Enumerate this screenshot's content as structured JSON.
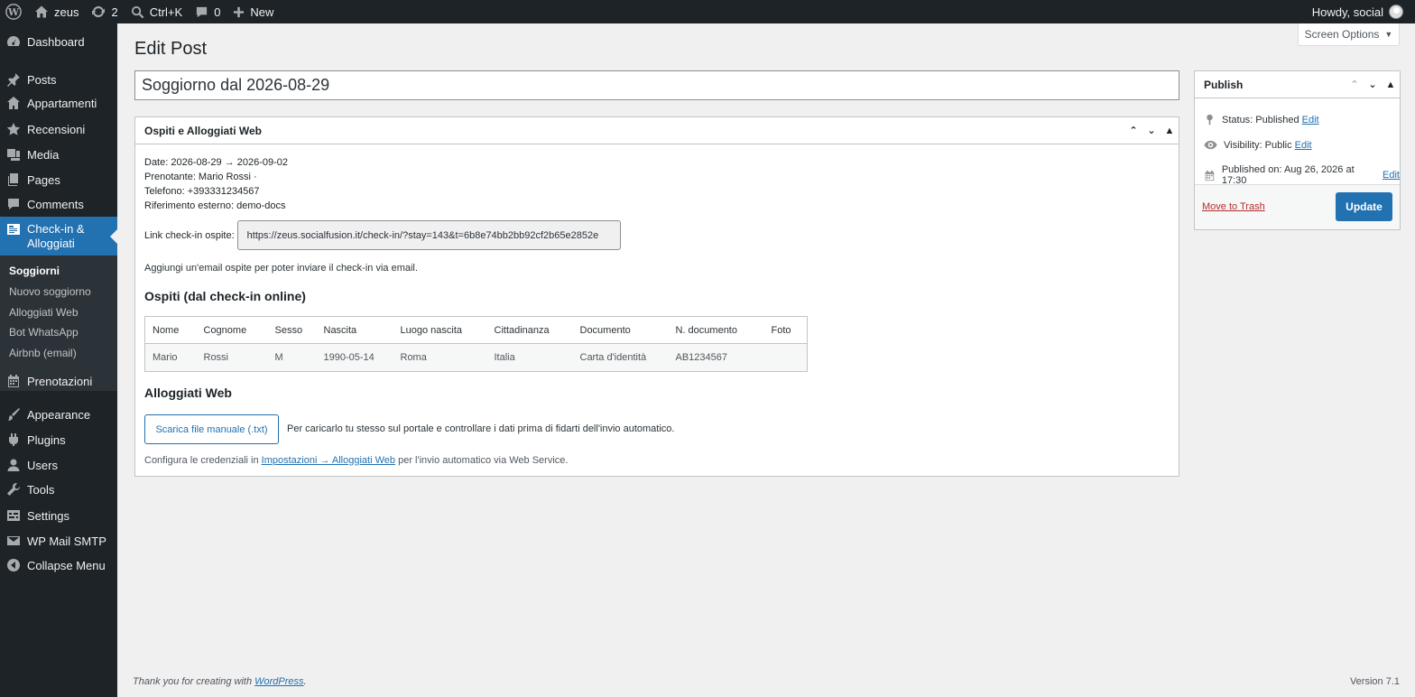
{
  "adminbar": {
    "site_name": "zeus",
    "updates_count": "2",
    "search_shortcut": "Ctrl+K",
    "comments_count": "0",
    "new_label": "New",
    "howdy": "Howdy, social"
  },
  "sidebar": {
    "items": [
      {
        "label": "Dashboard",
        "icon": "dashboard-icon"
      },
      {
        "label": "Posts",
        "icon": "pin-icon"
      },
      {
        "label": "Appartamenti",
        "icon": "building-icon"
      },
      {
        "label": "Recensioni",
        "icon": "star-icon"
      },
      {
        "label": "Media",
        "icon": "media-icon"
      },
      {
        "label": "Pages",
        "icon": "page-icon"
      },
      {
        "label": "Comments",
        "icon": "comment-icon"
      },
      {
        "label": "Check-in & Alloggiati",
        "icon": "id-card-icon"
      },
      {
        "label": "Prenotazioni",
        "icon": "calendar-icon"
      },
      {
        "label": "Appearance",
        "icon": "brush-icon"
      },
      {
        "label": "Plugins",
        "icon": "plugin-icon"
      },
      {
        "label": "Users",
        "icon": "user-icon"
      },
      {
        "label": "Tools",
        "icon": "wrench-icon"
      },
      {
        "label": "Settings",
        "icon": "settings-icon"
      },
      {
        "label": "WP Mail SMTP",
        "icon": "mail-icon"
      },
      {
        "label": "Collapse Menu",
        "icon": "collapse-icon"
      }
    ],
    "submenu": [
      "Soggiorni",
      "Nuovo soggiorno",
      "Alloggiati Web",
      "Bot WhatsApp",
      "Airbnb (email)"
    ]
  },
  "screen_options": "Screen Options",
  "page_title": "Edit Post",
  "post_title": "Soggiorno dal 2026-08-29",
  "metabox": {
    "title": "Ospiti e Alloggiati Web",
    "date_line": "Date: 2026-08-29 → 2026-09-02",
    "booker_line": "Prenotante: Mario Rossi ·",
    "phone_line": "Telefono: +393331234567",
    "ref_line": "Riferimento esterno: demo-docs",
    "link_label": "Link check-in ospite:",
    "link_value": "https://zeus.socialfusion.it/check-in/?stay=143&t=6b8e74bb2bb92cf2b65e2852e",
    "email_note": "Aggiungi un'email ospite per poter inviare il check-in via email.",
    "guests_title": "Ospiti (dal check-in online)",
    "table": {
      "headers": [
        "Nome",
        "Cognome",
        "Sesso",
        "Nascita",
        "Luogo nascita",
        "Cittadinanza",
        "Documento",
        "N. documento",
        "Foto"
      ],
      "rows": [
        [
          "Mario",
          "Rossi",
          "M",
          "1990-05-14",
          "Roma",
          "Italia",
          "Carta d'identità",
          "AB1234567",
          ""
        ]
      ]
    },
    "alloggiati_title": "Alloggiati Web",
    "download_button": "Scarica file manuale (.txt)",
    "download_desc": "Per caricarlo tu stesso sul portale e controllare i dati prima di fidarti dell'invio automatico.",
    "config_prefix": "Configura le credenziali in",
    "config_link": "Impostazioni → Alloggiati Web",
    "config_suffix": "per l'invio automatico via Web Service."
  },
  "publish": {
    "title": "Publish",
    "status": "Status: Published",
    "visibility": "Visibility: Public",
    "published_on": "Published on: Aug 26, 2026 at 17:30",
    "edit_label": "Edit",
    "trash": "Move to Trash",
    "update": "Update"
  },
  "footer": {
    "thanks": "Thank you for creating with",
    "wp_link": "WordPress",
    "version": "Version 7.1"
  },
  "colors": {
    "adminbar_bg": "#1d2327",
    "accent": "#2271b1",
    "trash": "#b32d2e"
  }
}
